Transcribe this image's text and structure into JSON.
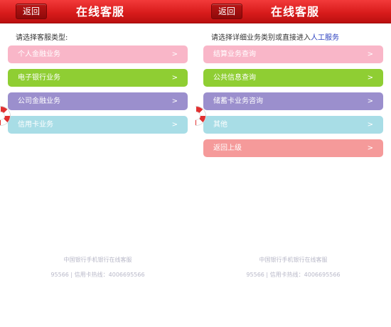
{
  "left": {
    "back_label": "返回",
    "title": "在线客服",
    "prompt": "请选择客服类型:",
    "items": [
      {
        "label": "个人金融业务",
        "color": "#f9b6c8"
      },
      {
        "label": "电子银行业务",
        "color": "#8fce33"
      },
      {
        "label": "公司金融业务",
        "color": "#9b8fcd"
      },
      {
        "label": "信用卡业务",
        "color": "#a8dde6"
      }
    ],
    "footer_line1": "中国银行手机银行在线客服",
    "footer_line2": "95566 | 信用卡热线：4006695566"
  },
  "right": {
    "back_label": "返回",
    "title": "在线客服",
    "prompt_text": "请选择详细业务类别或直接进入",
    "prompt_link": "人工服务",
    "items": [
      {
        "label": "结算业务查询",
        "color": "#f9b6c8"
      },
      {
        "label": "公共信息查询",
        "color": "#8fce33"
      },
      {
        "label": "储蓄卡业务咨询",
        "color": "#9b8fcd"
      },
      {
        "label": "其他",
        "color": "#a8dde6"
      },
      {
        "label": "返回上级",
        "color": "#f59a9a"
      }
    ],
    "footer_line1": "中国银行手机银行在线客服",
    "footer_line2": "95566 | 信用卡热线：4006695566"
  },
  "chevron_glyph": ">"
}
